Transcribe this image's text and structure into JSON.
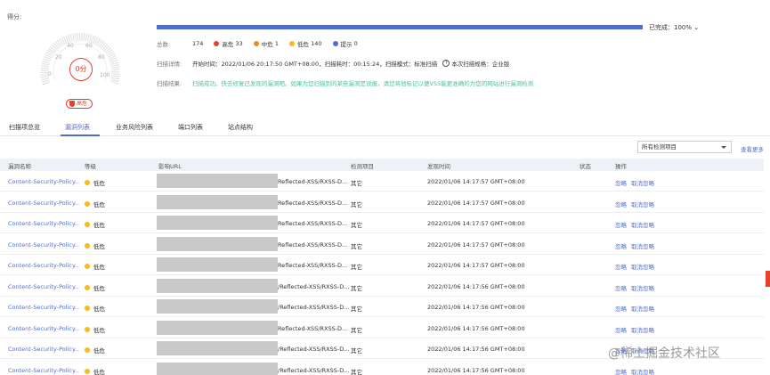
{
  "score_section": {
    "label": "得分:",
    "gauge_ticks": [
      "0",
      "20",
      "40",
      "60",
      "80",
      "100"
    ],
    "score_text": "0分",
    "risk_badge": "高危"
  },
  "progress": {
    "percent": 100,
    "text": "已完成：100% ⌄"
  },
  "totals": {
    "key": "总数:",
    "total": "174",
    "high_label": "高危",
    "high_count": "33",
    "high_color": "#e5412d",
    "medium_label": "中危",
    "medium_count": "1",
    "medium_color": "#f08a24",
    "low_label": "低危",
    "low_count": "140",
    "low_color": "#f5bb18",
    "info_label": "提示",
    "info_count": "0",
    "info_color": "#526ecc"
  },
  "details": {
    "key": "扫描详情:",
    "start": "开始时间：2022/01/06 20:17:50 GMT+08:00，扫描耗时：00:15:24，扫描模式：标准扫描",
    "spec": "本次扫描规格：企业版"
  },
  "result": {
    "key": "扫描结果:",
    "text": "扫描成功。快去修复已发现的漏洞吧。如果为您扫描到的某些漏洞是误报，请您将他标记以便VSS能更准确的为您的网站进行漏洞检测"
  },
  "tabs": [
    "扫描项总览",
    "漏洞列表",
    "业务风险列表",
    "端口列表",
    "站点结构"
  ],
  "filter": {
    "selected": "所有检测项目"
  },
  "view_more": "查看更多",
  "table": {
    "headers": [
      "漏洞名称",
      "等级",
      "影响URL",
      "检测项目",
      "发现时间",
      "状态",
      "操作"
    ],
    "rows": [
      {
        "name": "Content-Security-Policy...",
        "level": "低危",
        "url_suffix": "Reflected-XSS/RXSS-D...",
        "item": "其它",
        "time": "2022/01/06 14:17:57 GMT+08:00",
        "ops": [
          "忽略",
          "取消忽略"
        ]
      },
      {
        "name": "Content-Security-Policy...",
        "level": "低危",
        "url_suffix": "Reflected-XSS/RXSS-D...",
        "item": "其它",
        "time": "2022/01/06 14:17:57 GMT+08:00",
        "ops": [
          "忽略",
          "取消忽略"
        ]
      },
      {
        "name": "Content-Security-Policy...",
        "level": "低危",
        "url_suffix": "Reflected-XSS/RXSS-D...",
        "item": "其它",
        "time": "2022/01/06 14:17:57 GMT+08:00",
        "ops": [
          "忽略",
          "取消忽略"
        ]
      },
      {
        "name": "Content-Security-Policy...",
        "level": "低危",
        "url_suffix": "Reflected-XSS/RXSS-D...",
        "item": "其它",
        "time": "2022/01/06 14:17:57 GMT+08:00",
        "ops": [
          "忽略",
          "取消忽略"
        ]
      },
      {
        "name": "Content-Security-Policy...",
        "level": "低危",
        "url_suffix": "Reflected-XSS/RXSS-D...",
        "item": "其它",
        "time": "2022/01/06 14:17:57 GMT+08:00",
        "ops": [
          "忽略",
          "取消忽略"
        ]
      },
      {
        "name": "Content-Security-Policy...",
        "level": "低危",
        "url_suffix": "/Reflected-XSS/RXSS-D...",
        "item": "其它",
        "time": "2022/01/06 14:17:56 GMT+08:00",
        "ops": [
          "忽略",
          "取消忽略"
        ]
      },
      {
        "name": "Content-Security-Policy...",
        "level": "低危",
        "url_suffix": "/Reflected-XSS/RXSS-D...",
        "item": "其它",
        "time": "2022/01/06 14:17:56 GMT+08:00",
        "ops": [
          "忽略",
          "取消忽略"
        ]
      },
      {
        "name": "Content-Security-Policy...",
        "level": "低危",
        "url_suffix": "Reflected-XSS/RXSS-D...",
        "item": "其它",
        "time": "2022/01/06 14:17:56 GMT+08:00",
        "ops": [
          "忽略",
          "取消忽略"
        ]
      },
      {
        "name": "Content-Security-Policy...",
        "level": "低危",
        "url_suffix": "/Reflected-XSS/RXSS-D...",
        "item": "其它",
        "time": "2022/01/06 14:17:56 GMT+08:00",
        "ops": [
          "忽略",
          "取消忽略"
        ]
      },
      {
        "name": "Content-Security-Policy...",
        "level": "低危",
        "url_suffix": "/Reflected-XSS/RXSS-D...",
        "item": "其它",
        "time": "2022/01/06 14:17:56 GMT+08:00",
        "ops": [
          "忽略",
          "取消忽略"
        ]
      }
    ]
  },
  "watermark": "@稀土掘金技术社区"
}
